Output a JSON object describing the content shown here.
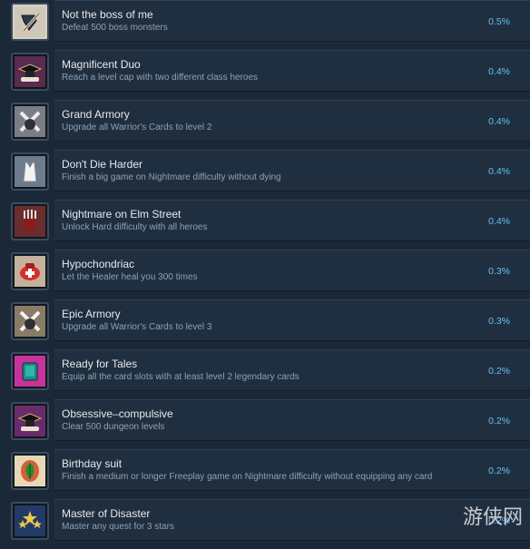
{
  "achievements": [
    {
      "title": "Not the boss of me",
      "description": "Defeat 500 boss monsters",
      "percent": "0.5%",
      "icon": "shield-sword-icon"
    },
    {
      "title": "Magnificent Duo",
      "description": "Reach a level cap with two different class heroes",
      "percent": "0.4%",
      "icon": "grad-cap-scroll-icon"
    },
    {
      "title": "Grand Armory",
      "description": "Upgrade all Warrior's Cards to level 2",
      "percent": "0.4%",
      "icon": "crossed-blades-icon"
    },
    {
      "title": "Don't Die Harder",
      "description": "Finish a big game on Nightmare difficulty without dying",
      "percent": "0.4%",
      "icon": "tank-top-icon"
    },
    {
      "title": "Nightmare on Elm Street",
      "description": "Unlock Hard difficulty with all heroes",
      "percent": "0.4%",
      "icon": "claw-glove-icon"
    },
    {
      "title": "Hypochondriac",
      "description": "Let the Healer heal you 300 times",
      "percent": "0.3%",
      "icon": "medkit-icon"
    },
    {
      "title": "Epic Armory",
      "description": "Upgrade all Warrior's Cards to level 3",
      "percent": "0.3%",
      "icon": "crossed-blades-icon"
    },
    {
      "title": "Ready for Tales",
      "description": "Equip all the card slots with at least level 2 legendary cards",
      "percent": "0.2%",
      "icon": "card-icon"
    },
    {
      "title": "Obsessive–compulsive",
      "description": "Clear 500 dungeon levels",
      "percent": "0.2%",
      "icon": "grad-cap-scroll-icon"
    },
    {
      "title": "Birthday suit",
      "description": "Finish a medium or longer Freeplay game on Nightmare difficulty without equipping any card",
      "percent": "0.2%",
      "icon": "fig-leaf-icon"
    },
    {
      "title": "Master of Disaster",
      "description": "Master any quest for 3 stars",
      "percent": "0.2%",
      "icon": "stars-icon"
    }
  ],
  "watermark": "游侠网"
}
